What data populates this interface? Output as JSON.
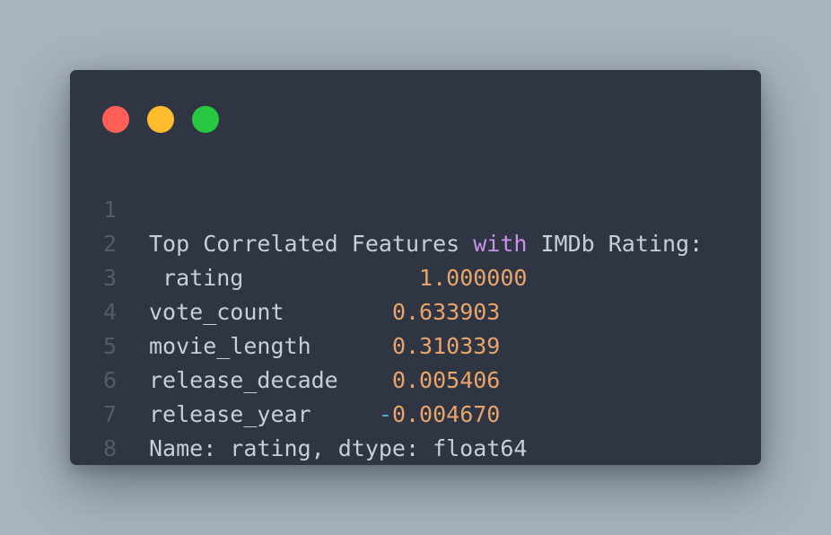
{
  "window": {
    "controls": [
      "close",
      "minimize",
      "maximize"
    ],
    "colors": {
      "background": "#2f3542",
      "close": "#ff5f57",
      "minimize": "#febc2e",
      "maximize": "#28c840",
      "text": "#c9ced6",
      "keyword": "#c792ea",
      "number": "#e8a46b",
      "line_number": "#545b68"
    }
  },
  "code": {
    "lines": [
      {
        "number": "1",
        "pre": "Top Correlated Features ",
        "keyword": "with",
        "post": " IMDb Rating:"
      },
      {
        "number": "2",
        "label": " rating            ",
        "sign": " ",
        "value": "1.000000"
      },
      {
        "number": "3",
        "label": "vote_count        ",
        "sign": "",
        "value": "0.633903"
      },
      {
        "number": "4",
        "label": "movie_length      ",
        "sign": "",
        "value": "0.310339"
      },
      {
        "number": "5",
        "label": "release_decade    ",
        "sign": "",
        "value": "0.005406"
      },
      {
        "number": "6",
        "label": "release_year     ",
        "sign": "-",
        "value": "0.004670"
      },
      {
        "number": "7",
        "text": "Name: rating, dtype: float64"
      },
      {
        "number": "8",
        "text": ""
      }
    ]
  }
}
